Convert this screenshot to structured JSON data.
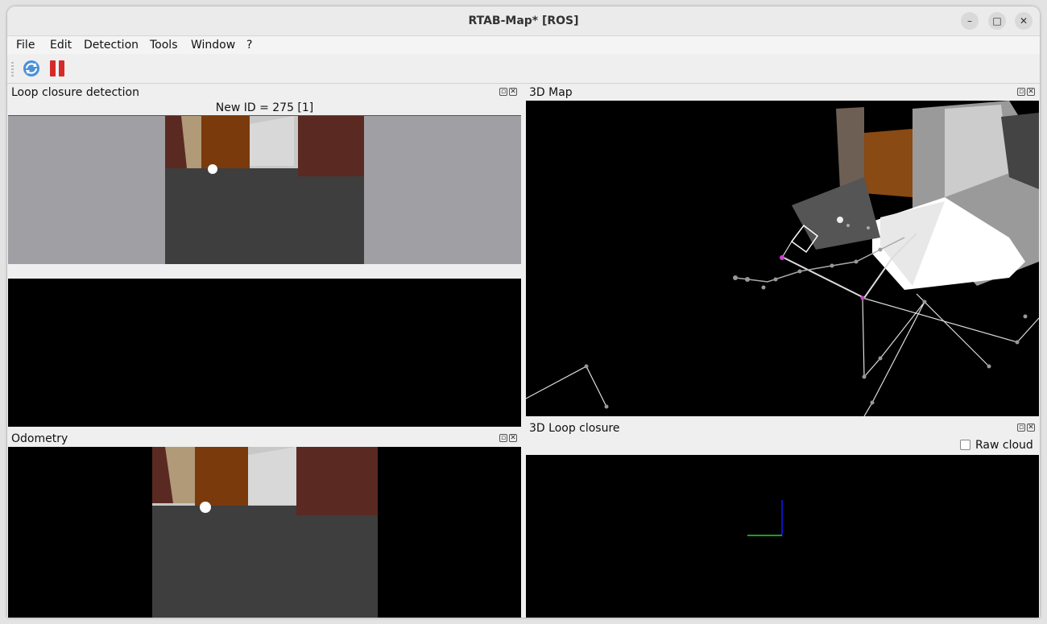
{
  "window": {
    "title": "RTAB-Map* [ROS]"
  },
  "menu": [
    "File",
    "Edit",
    "Detection",
    "Tools",
    "Window",
    "?"
  ],
  "toolbar": {
    "icons": [
      "refresh-icon",
      "pause-icon"
    ]
  },
  "docks": {
    "loop_closure": {
      "title": "Loop closure detection",
      "new_id_label": "New ID = 275 [1]"
    },
    "odometry": {
      "title": "Odometry"
    },
    "map3d": {
      "title": "3D Map"
    },
    "loop3d": {
      "title": "3D Loop closure",
      "raw_cloud_label": "Raw  cloud",
      "raw_cloud_checked": false
    }
  },
  "colors": {
    "floor": "#3e3e3e",
    "door": "#7a3a0c",
    "brick": "#5a2a22",
    "wall": "#d8d8d8",
    "sidewall": "#9fa0a5",
    "axis_x": "#1aa01a",
    "axis_y": "#1010c0"
  }
}
